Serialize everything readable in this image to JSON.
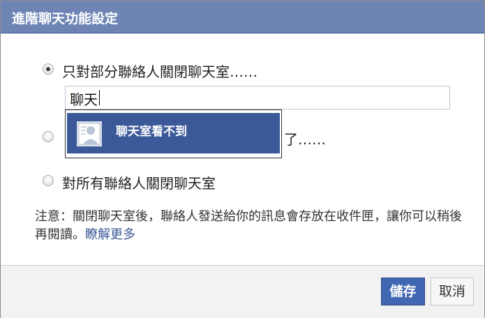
{
  "dialog": {
    "title": "進階聊天功能設定"
  },
  "options": [
    {
      "label": "只對部分聯絡人關閉聊天室……",
      "checked": true
    },
    {
      "label_visible_end": "了……",
      "checked": false
    },
    {
      "label": "對所有聯絡人關閉聊天室",
      "checked": false
    }
  ],
  "search": {
    "value": "聊天"
  },
  "suggestions": [
    {
      "name": "聊天室看不到",
      "icon": "default-avatar-icon"
    }
  ],
  "note": {
    "text": "注意：關閉聊天室後，聯絡人發送給你的訊息會存放在收件匣，讓你可以稍後再閱讀。",
    "link": "瞭解更多"
  },
  "buttons": {
    "save": "儲存",
    "cancel": "取消"
  },
  "colors": {
    "titlebar": "#6d84b4",
    "primary": "#4267b2",
    "highlight": "#3b5998",
    "link": "#3b5998"
  }
}
